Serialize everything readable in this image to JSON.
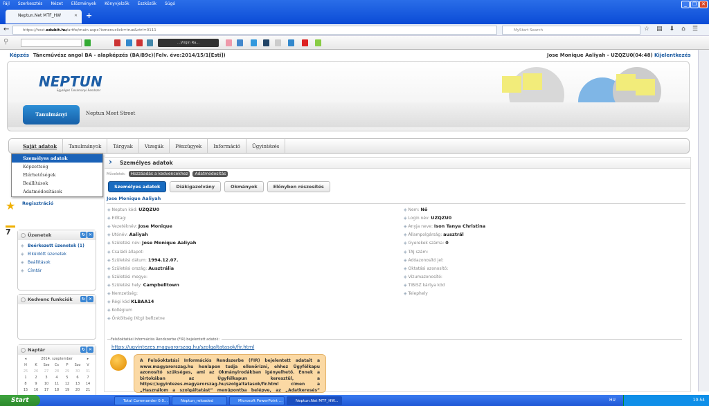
{
  "browser": {
    "menu": [
      "Fájl",
      "Szerkesztés",
      "Nézet",
      "Előzmények",
      "Könyvjelzők",
      "Eszközök",
      "Súgó"
    ],
    "tab_title": "Neptun.Net MTF_HW",
    "url_prefix": "https://host.",
    "url_domain": "edubit.hu",
    "url_rest": "/artfw/main.aspx?ismenuclick=true&ctrl=0111",
    "search_placeholder": "MyStart Search",
    "toolbar_media": "...Virgin Ra..."
  },
  "info": {
    "kepzes_label": "Képzés",
    "kepzes": "Táncművész angol BA - alapképzés (BA/B9c)(Felv. éve:2014/15/1[Esti])",
    "user": "Jose Monique Aaliyah - UZQZU0",
    "timer": "(04:48)",
    "logout": "Kijelentkezés"
  },
  "header": {
    "logo": "NEPTUN",
    "logo_sub": "Egységes Tanulmányi Rendszer",
    "system_btn": "Tanulmányi rendszer",
    "meet_street": "Neptun Meet Street"
  },
  "mainnav": [
    "Saját adatok",
    "Tanulmányok",
    "Tárgyak",
    "Vizsgák",
    "Pénzügyek",
    "Információ",
    "Ügyintézés"
  ],
  "dropdown": [
    "Személyes adatok",
    "Képzettség",
    "Elérhetőségek",
    "Beállítások",
    "Adatmódosítások"
  ],
  "sidebar": {
    "registration": "Regisztráció",
    "messages_title": "Üzenetek",
    "messages": [
      "Beérkezett üzenetek (1)",
      "Elküldött üzenetek",
      "Beállítások",
      "Címtár"
    ],
    "favorites_title": "Kedvenc funkciók",
    "calendar_title": "Naptár",
    "calendar_month": "2014. szeptember",
    "calendar_days": [
      "H",
      "K",
      "Sze",
      "Cs",
      "P",
      "Szo",
      "V"
    ],
    "calendar_weeks": [
      [
        "25",
        "26",
        "27",
        "28",
        "29",
        "30",
        "31"
      ],
      [
        "1",
        "2",
        "3",
        "4",
        "5",
        "6",
        "7"
      ],
      [
        "8",
        "9",
        "10",
        "11",
        "12",
        "13",
        "14"
      ],
      [
        "15",
        "16",
        "17",
        "18",
        "19",
        "20",
        "21"
      ]
    ],
    "calendar_icon_day": "7"
  },
  "content": {
    "title": "Személyes adatok",
    "functions_label": "Műveletek:",
    "func_buttons": [
      "Hozzáadás a kedvencekhez",
      "Adatmódosítás"
    ],
    "tabs": [
      "Személyes adatok",
      "Diákigazolvány",
      "Okmányok",
      "Előnyben részesítés"
    ],
    "person_name": "Jose Monique Aaliyah",
    "left_fields": [
      [
        "Neptun kód:",
        "UZQZU0"
      ],
      [
        "Előtag:",
        ""
      ],
      [
        "Vezetéknév:",
        "Jose Monique"
      ],
      [
        "Utónév:",
        "Aaliyah"
      ],
      [
        "Születési név:",
        "Jose Monique Aaliyah"
      ],
      [
        "Családi állapot:",
        ""
      ],
      [
        "Születési dátum:",
        "1994.12.07."
      ],
      [
        "Születési ország:",
        "Ausztrália"
      ],
      [
        "Születési megye:",
        ""
      ],
      [
        "Születési hely:",
        "Campbelltown"
      ],
      [
        "Nemzetiség:",
        ""
      ],
      [
        "Régi kód",
        "KLBAA14"
      ],
      [
        "Kollégium",
        ""
      ],
      [
        "Önköltség (Ktg) befizetve",
        ""
      ]
    ],
    "right_fields": [
      [
        "Nem:",
        "Nő"
      ],
      [
        "Login név:",
        "UZQZU0"
      ],
      [
        "Anyja neve:",
        "Ison Tanya Christina"
      ],
      [
        "Állampolgárság:",
        "ausztrál"
      ],
      [
        "Gyerekek száma:",
        "0"
      ],
      [
        "TAJ szám:",
        ""
      ],
      [
        "Adóazonosító jel:",
        ""
      ],
      [
        "Oktatási azonosító:",
        ""
      ],
      [
        "Vízumazonosító:",
        ""
      ],
      [
        "TIBISZ kártya kód",
        ""
      ],
      [
        "Telephely",
        ""
      ]
    ],
    "fir_label": "Felsőoktatási Információs Rendszerbe (FIR) bejelentett adatok:",
    "fir_link": "https://ugyintezes.magyarorszag.hu/szolgaltatasok/fir.html",
    "fir_text": "A Felsőoktatási Információs Rendszerbe (FIR) bejelentett adatait a www.magyarorszag.hu honlapon tudja ellenőrizni, ehhez Ügyfélkapu azonosító szükséges, ami az Okmányirodákban igényelhető. Ennek a birtokában az Ügyfélkapun keresztül, a https://ugyintezes.magyarorszag.hu/szolgaltatasok/fir.html címen a „Használom a szolgáltatást” menüpontba belépve, az „Adatkeresés” menüpont (baloldalt fent) kiválasztása, majd az Oktatási azonosító"
  },
  "taskbar": {
    "start": "Start",
    "tasks": [
      "Total Commander 0.0...",
      "Neptun_reloaded",
      "Microsoft PowerPoint ...",
      "Neptun.Net MTF_HW..."
    ],
    "lang": "HU",
    "clock": "10:54"
  }
}
